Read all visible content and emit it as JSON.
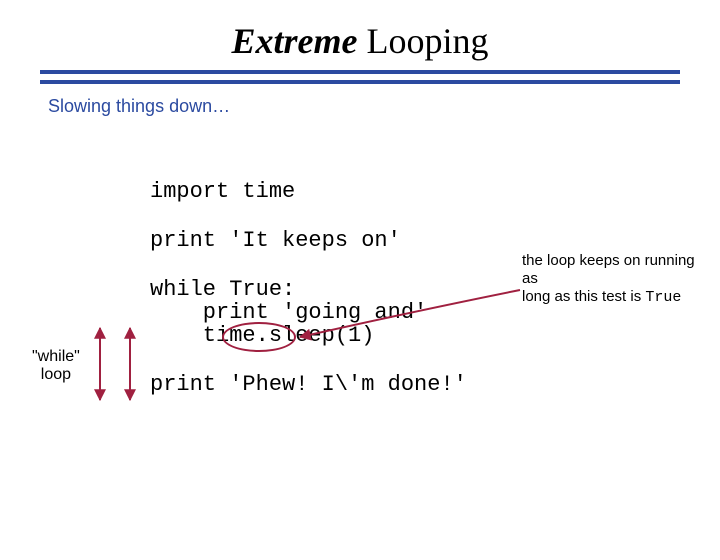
{
  "title": {
    "part1": "Extreme",
    "part2": " Looping"
  },
  "subtitle": "Slowing things down…",
  "code": {
    "l1": "import time",
    "l2": "print 'It keeps on'",
    "l3": "while True:",
    "l4": "    print 'going and'",
    "l5": "    time.sleep(1)",
    "l6": "print 'Phew! I\\'m done!'"
  },
  "labels": {
    "while_line1": "\"while\"",
    "while_line2": "loop"
  },
  "annot": {
    "line1": "the loop keeps on running as",
    "line2_pre": "long as this test is ",
    "line2_code": "True"
  }
}
